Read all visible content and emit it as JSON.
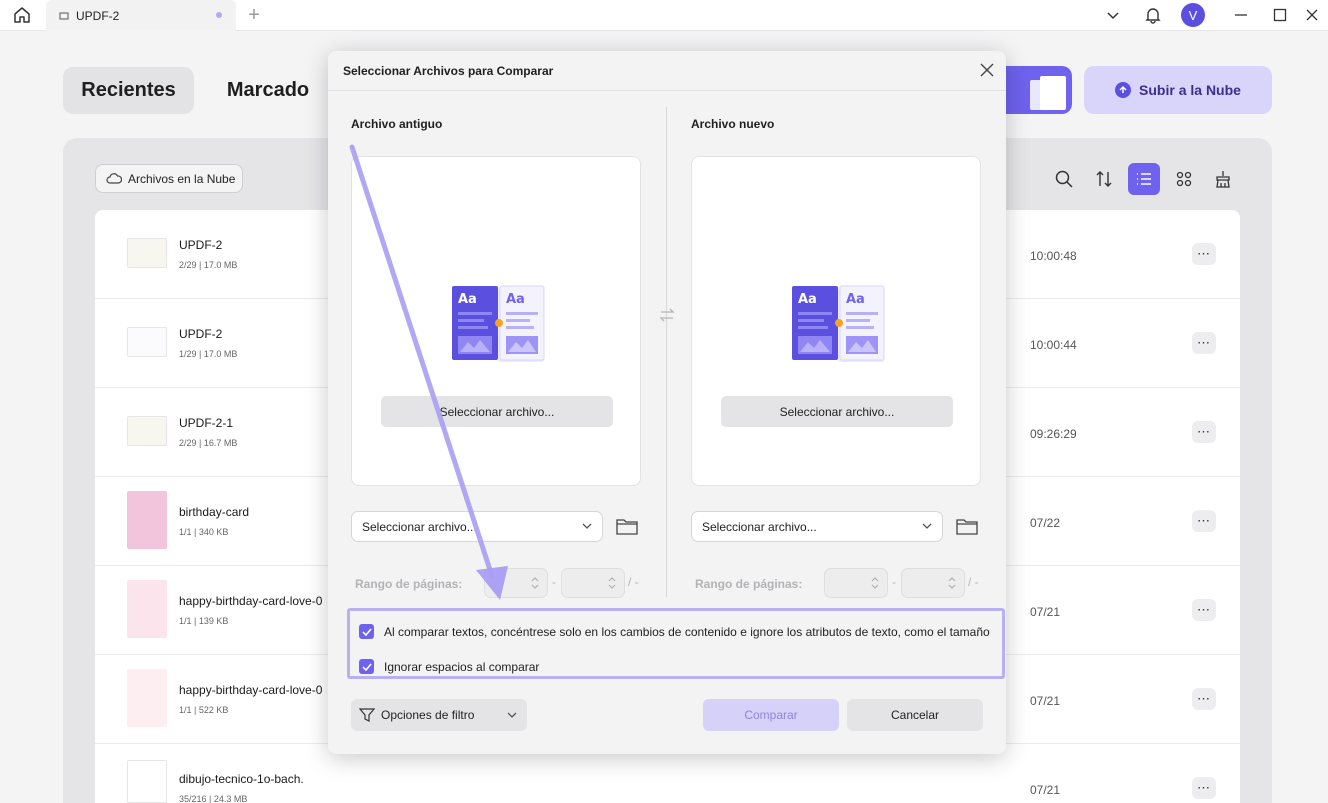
{
  "titlebar": {
    "tab_label": "UPDF-2",
    "avatar_letter": "V"
  },
  "background": {
    "tabs": [
      "Recientes",
      "Marcado"
    ],
    "upload_label": "Subir a la Nube",
    "cloud_button": "Archivos en la Nube",
    "files": [
      {
        "name": "UPDF-2",
        "meta": "2/29 | 17.0 MB",
        "time": "10:00:48"
      },
      {
        "name": "UPDF-2",
        "meta": "1/29 | 17.0 MB",
        "time": "10:00:44"
      },
      {
        "name": "UPDF-2-1",
        "meta": "2/29 | 16.7 MB",
        "time": "09:26:29"
      },
      {
        "name": "birthday-card",
        "meta": "1/1 | 340 KB",
        "time": "07/22"
      },
      {
        "name": "happy-birthday-card-love-0",
        "meta": "1/1 | 139 KB",
        "time": "07/21"
      },
      {
        "name": "happy-birthday-card-love-0",
        "meta": "1/1 | 522 KB",
        "time": "07/21"
      },
      {
        "name": "dibujo-tecnico-1o-bach.",
        "meta": "35/216 | 24.3 MB",
        "time": "07/21"
      }
    ],
    "more_label": "⋯"
  },
  "modal": {
    "title": "Seleccionar Archivos para Comparar",
    "old": {
      "title": "Archivo antiguo",
      "select_button": "Seleccionar archivo...",
      "dropdown_value": "Seleccionar archivo...",
      "range_label": "Rango de páginas:"
    },
    "new": {
      "title": "Archivo nuevo",
      "select_button": "Seleccionar archivo...",
      "dropdown_value": "Seleccionar archivo...",
      "range_label": "Rango de páginas:"
    },
    "range_dash": "-",
    "range_slash": "/ -",
    "options": [
      {
        "label": "Al comparar textos, concéntrese solo en los cambios de contenido e ignore los atributos de texto, como el tamaño",
        "checked": true
      },
      {
        "label": "Ignorar espacios al comparar",
        "checked": true
      }
    ],
    "filter_button": "Opciones de filtro",
    "compare_button": "Comparar",
    "cancel_button": "Cancelar"
  },
  "colors": {
    "accent": "#6f62ee",
    "highlight_box": "#b9b0f3",
    "annotation_arrow": "#a99df3"
  }
}
